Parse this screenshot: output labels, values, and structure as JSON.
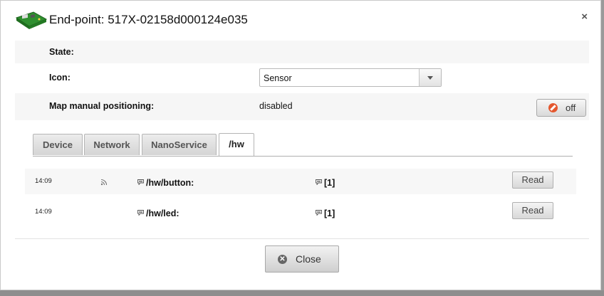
{
  "dialog": {
    "title": "End-point: 517X-02158d000124e035",
    "close_glyph": "×"
  },
  "fields": {
    "state_label": "State:",
    "icon_label": "Icon:",
    "icon_value": "Sensor",
    "map_label": "Map manual positioning:",
    "map_value": "disabled",
    "toggle_label": "off"
  },
  "tabs": [
    {
      "label": "Device"
    },
    {
      "label": "Network"
    },
    {
      "label": "NanoService"
    },
    {
      "label": "/hw",
      "active": true
    }
  ],
  "resources": [
    {
      "time": "14:09",
      "observable": true,
      "path": "/hw/button:",
      "value": "[1]",
      "action": "Read"
    },
    {
      "time": "14:09",
      "observable": false,
      "path": "/hw/led:",
      "value": "[1]",
      "action": "Read"
    }
  ],
  "footer": {
    "close_label": "Close"
  },
  "colors": {
    "toggle_off_icon": "#e4572e",
    "device_board": "#2f8f2f"
  },
  "icons": {
    "device": "circuit-board-icon",
    "rss": "rss-feed-icon",
    "resource": "resource-comment-icon",
    "toggle": "no-entry-icon",
    "close": "close-circle-icon"
  }
}
